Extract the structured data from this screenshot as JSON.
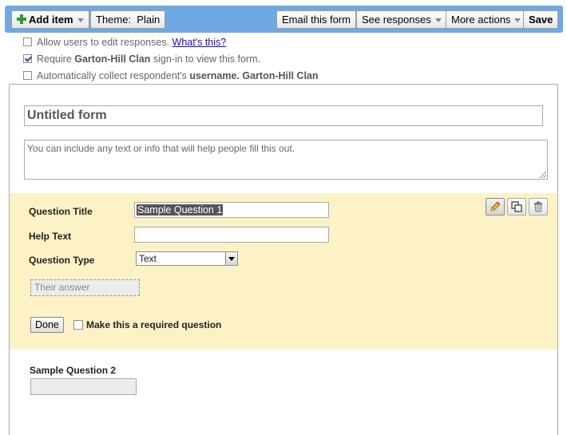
{
  "toolbar": {
    "add_item": "Add item",
    "theme": "Theme:  Plain",
    "email": "Email this form",
    "see_responses": "See responses",
    "more_actions": "More actions",
    "save": "Save"
  },
  "options": {
    "allow_edit": {
      "label": "Allow users to edit responses.",
      "link": "What's this?",
      "checked": false
    },
    "require_signin": {
      "prefix": "Require ",
      "org": "Garton-Hill Clan",
      "suffix": " sign-in to view this form.",
      "checked": true
    },
    "collect_username": {
      "prefix": "Automatically collect respondent's ",
      "bold": "username. Garton-Hill Clan",
      "checked": false
    }
  },
  "form": {
    "title": "Untitled form",
    "description": "You can include any text or info that will help people fill this out."
  },
  "editor": {
    "question_title_label": "Question Title",
    "question_title_value": "Sample Question 1",
    "help_text_label": "Help Text",
    "help_text_value": "",
    "question_type_label": "Question Type",
    "question_type_value": "Text",
    "answer_placeholder": "Their answer",
    "done": "Done",
    "required_label": "Make this a required question",
    "required_checked": false
  },
  "question2": {
    "title": "Sample Question 2"
  },
  "colors": {
    "toolbar_bg": "#6ea9e3",
    "editor_bg": "#fdf2c6",
    "link": "#1a0dab"
  },
  "icons": [
    "plus-icon",
    "chevron-down-icon",
    "pencil-icon",
    "duplicate-icon",
    "trash-icon",
    "checkmark-icon"
  ]
}
